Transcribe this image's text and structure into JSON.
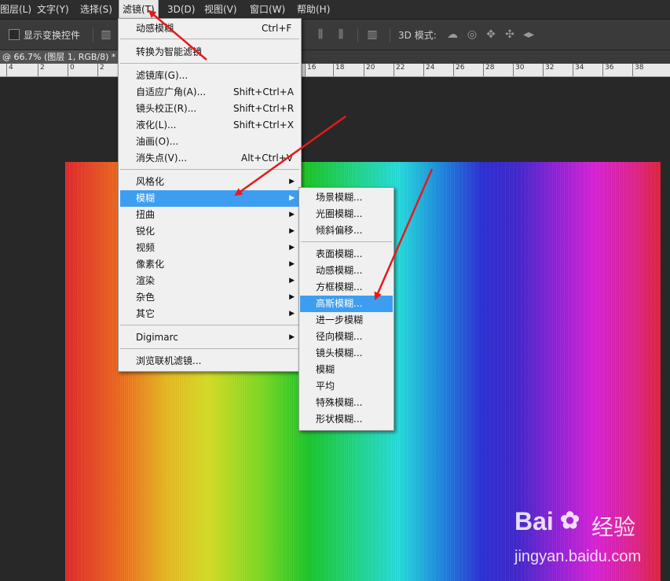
{
  "menubar": {
    "items": [
      "图层(L)",
      "文字(Y)",
      "选择(S)",
      "滤镜(T)",
      "3D(D)",
      "视图(V)",
      "窗口(W)",
      "帮助(H)"
    ]
  },
  "options_bar": {
    "show_transform_controls": "显示变换控件",
    "mode_3d_label": "3D 模式:"
  },
  "document": {
    "tab_title": "@ 66.7% (图层 1, RGB/8) *"
  },
  "ruler": {
    "labels": [
      "4",
      "2",
      "0",
      "2",
      "16",
      "18",
      "20",
      "22",
      "24",
      "26",
      "28",
      "30",
      "32",
      "34",
      "36",
      "38"
    ]
  },
  "filter_menu": {
    "items": [
      {
        "label": "动感模糊",
        "shortcut": "Ctrl+F"
      },
      {
        "label": "转换为智能滤镜",
        "shortcut": ""
      },
      {
        "label": "滤镜库(G)...",
        "shortcut": ""
      },
      {
        "label": "自适应广角(A)...",
        "shortcut": "Shift+Ctrl+A"
      },
      {
        "label": "镜头校正(R)...",
        "shortcut": "Shift+Ctrl+R"
      },
      {
        "label": "液化(L)...",
        "shortcut": "Shift+Ctrl+X"
      },
      {
        "label": "油画(O)...",
        "shortcut": ""
      },
      {
        "label": "消失点(V)...",
        "shortcut": "Alt+Ctrl+V"
      },
      {
        "label": "风格化",
        "shortcut": ""
      },
      {
        "label": "模糊",
        "shortcut": ""
      },
      {
        "label": "扭曲",
        "shortcut": ""
      },
      {
        "label": "锐化",
        "shortcut": ""
      },
      {
        "label": "视频",
        "shortcut": ""
      },
      {
        "label": "像素化",
        "shortcut": ""
      },
      {
        "label": "渲染",
        "shortcut": ""
      },
      {
        "label": "杂色",
        "shortcut": ""
      },
      {
        "label": "其它",
        "shortcut": ""
      },
      {
        "label": "Digimarc",
        "shortcut": ""
      },
      {
        "label": "浏览联机滤镜...",
        "shortcut": ""
      }
    ]
  },
  "blur_submenu": {
    "items": [
      "场景模糊...",
      "光圈模糊...",
      "倾斜偏移...",
      "表面模糊...",
      "动感模糊...",
      "方框模糊...",
      "高斯模糊...",
      "进一步模糊",
      "径向模糊...",
      "镜头模糊...",
      "模糊",
      "平均",
      "特殊模糊...",
      "形状模糊..."
    ]
  },
  "watermark": {
    "brand": "Bai",
    "brand2": "经验",
    "url": "jingyan.baidu.com"
  },
  "colors": {
    "highlight": "#3d9ef1",
    "arrow": "#e8191b"
  }
}
